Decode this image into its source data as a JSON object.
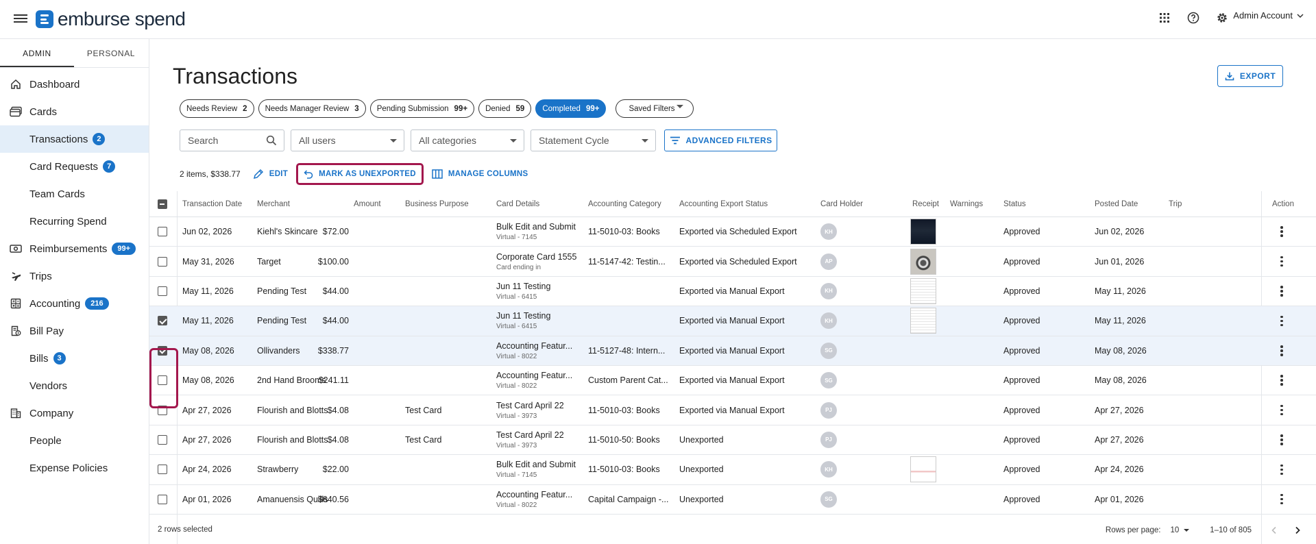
{
  "header": {
    "brand": "emburse spend",
    "account": "Admin Account",
    "icons": [
      "apps-grid-icon",
      "help-icon",
      "gear-icon"
    ]
  },
  "sidebar": {
    "tabs": [
      "ADMIN",
      "PERSONAL"
    ],
    "active_tab": "ADMIN",
    "items": [
      {
        "label": "Dashboard",
        "icon": "home-icon"
      },
      {
        "label": "Cards",
        "icon": "cards-icon"
      },
      {
        "label": "Transactions",
        "badge": "2",
        "sub": true,
        "active": true
      },
      {
        "label": "Card Requests",
        "badge": "7",
        "sub": true
      },
      {
        "label": "Team Cards",
        "sub": true
      },
      {
        "label": "Recurring Spend",
        "sub": true
      },
      {
        "label": "Reimbursements",
        "icon": "money-icon",
        "badge": "99+"
      },
      {
        "label": "Trips",
        "icon": "plane-icon"
      },
      {
        "label": "Accounting",
        "icon": "calculator-icon",
        "badge": "216"
      },
      {
        "label": "Bill Pay",
        "icon": "bill-icon"
      },
      {
        "label": "Bills",
        "badge": "3",
        "sub": true
      },
      {
        "label": "Vendors",
        "sub": true
      },
      {
        "label": "Company",
        "icon": "building-icon"
      },
      {
        "label": "People",
        "sub": true
      },
      {
        "label": "Expense Policies",
        "sub": true
      }
    ]
  },
  "page": {
    "title": "Transactions",
    "export_label": "EXPORT"
  },
  "status_chips": [
    {
      "label": "Needs Review",
      "count": "2"
    },
    {
      "label": "Needs Manager Review",
      "count": "3"
    },
    {
      "label": "Pending Submission",
      "count": "99+"
    },
    {
      "label": "Denied",
      "count": "59"
    },
    {
      "label": "Completed",
      "count": "99+",
      "active": true
    }
  ],
  "saved_filters_label": "Saved Filters",
  "filters": {
    "search_placeholder": "Search",
    "users": "All users",
    "categories": "All categories",
    "statement_cycle": "Statement Cycle",
    "advanced_label": "ADVANCED FILTERS"
  },
  "selection_bar": {
    "summary": "2 items, $338.77",
    "edit_label": "EDIT",
    "mark_unexported_label": "MARK AS UNEXPORTED",
    "manage_columns_label": "MANAGE COLUMNS"
  },
  "table": {
    "columns": [
      "Transaction Date",
      "Merchant",
      "Amount",
      "Business Purpose",
      "Card Details",
      "Accounting Category",
      "Accounting Export Status",
      "Card Holder",
      "Receipt",
      "Warnings",
      "Status",
      "Posted Date",
      "Trip",
      "Action"
    ],
    "rows": [
      {
        "checked": false,
        "date": "Jun 02, 2026",
        "merchant": "Kiehl's Skincare",
        "amount": "$72.00",
        "purpose": "",
        "card": "Bulk Edit and Submit",
        "card_sub": "Virtual - 7145",
        "category": "11-5010-03: Books",
        "export_status": "Exported via Scheduled Export",
        "holder": "KH",
        "receipt": "dark",
        "status": "Approved",
        "posted": "Jun 02, 2026"
      },
      {
        "checked": false,
        "date": "May 31, 2026",
        "merchant": "Target",
        "amount": "$100.00",
        "purpose": "",
        "card": "Corporate Card 1555",
        "card_sub": "Card ending in",
        "category": "11-5147-42: Testin...",
        "export_status": "Exported via Scheduled Export",
        "holder": "AP",
        "receipt": "photo",
        "status": "Approved",
        "posted": "Jun 01, 2026"
      },
      {
        "checked": false,
        "date": "May 11, 2026",
        "merchant": "Pending Test",
        "amount": "$44.00",
        "purpose": "",
        "card": "Jun 11 Testing",
        "card_sub": "Virtual - 6415",
        "category": "",
        "export_status": "Exported via Manual Export",
        "holder": "KH",
        "receipt": "doc",
        "status": "Approved",
        "posted": "May 11, 2026"
      },
      {
        "checked": true,
        "date": "May 11, 2026",
        "merchant": "Pending Test",
        "amount": "$44.00",
        "purpose": "",
        "card": "Jun 11 Testing",
        "card_sub": "Virtual - 6415",
        "category": "",
        "export_status": "Exported via Manual Export",
        "holder": "KH",
        "receipt": "doc",
        "status": "Approved",
        "posted": "May 11, 2026"
      },
      {
        "checked": true,
        "date": "May 08, 2026",
        "merchant": "Ollivanders",
        "amount": "$338.77",
        "purpose": "",
        "card": "Accounting Featur...",
        "card_sub": "Virtual - 8022",
        "category": "11-5127-48: Intern...",
        "export_status": "Exported via Manual Export",
        "holder": "SG",
        "receipt": "",
        "status": "Approved",
        "posted": "May 08, 2026"
      },
      {
        "checked": false,
        "date": "May 08, 2026",
        "merchant": "2nd Hand Brooms",
        "amount": "$241.11",
        "purpose": "",
        "card": "Accounting Featur...",
        "card_sub": "Virtual - 8022",
        "category": "Custom Parent Cat...",
        "export_status": "Exported via Manual Export",
        "holder": "SG",
        "receipt": "",
        "status": "Approved",
        "posted": "May 08, 2026"
      },
      {
        "checked": false,
        "date": "Apr 27, 2026",
        "merchant": "Flourish and Blotts",
        "amount": "$4.08",
        "purpose": "Test Card",
        "card": "Test Card April 22",
        "card_sub": "Virtual - 3973",
        "category": "11-5010-03: Books",
        "export_status": "Exported via Manual Export",
        "holder": "PJ",
        "receipt": "",
        "status": "Approved",
        "posted": "Apr 27, 2026"
      },
      {
        "checked": false,
        "date": "Apr 27, 2026",
        "merchant": "Flourish and Blotts",
        "amount": "$4.08",
        "purpose": "Test Card",
        "card": "Test Card April 22",
        "card_sub": "Virtual - 3973",
        "category": "11-5010-50: Books",
        "export_status": "Unexported",
        "holder": "PJ",
        "receipt": "",
        "status": "Approved",
        "posted": "Apr 27, 2026"
      },
      {
        "checked": false,
        "date": "Apr 24, 2026",
        "merchant": "Strawberry",
        "amount": "$22.00",
        "purpose": "",
        "card": "Bulk Edit and Submit",
        "card_sub": "Virtual - 7145",
        "category": "11-5010-03: Books",
        "export_status": "Unexported",
        "holder": "KH",
        "receipt": "docred",
        "status": "Approved",
        "posted": "Apr 24, 2026"
      },
      {
        "checked": false,
        "date": "Apr 01, 2026",
        "merchant": "Amanuensis Quills",
        "amount": "$640.56",
        "purpose": "",
        "card": "Accounting Featur...",
        "card_sub": "Virtual - 8022",
        "category": "Capital Campaign -...",
        "export_status": "Unexported",
        "holder": "SG",
        "receipt": "",
        "status": "Approved",
        "posted": "Apr 01, 2026"
      }
    ]
  },
  "footer": {
    "rows_selected": "2 rows selected",
    "rows_per_page_label": "Rows per page:",
    "rows_per_page": "10",
    "range": "1–10 of 805"
  }
}
